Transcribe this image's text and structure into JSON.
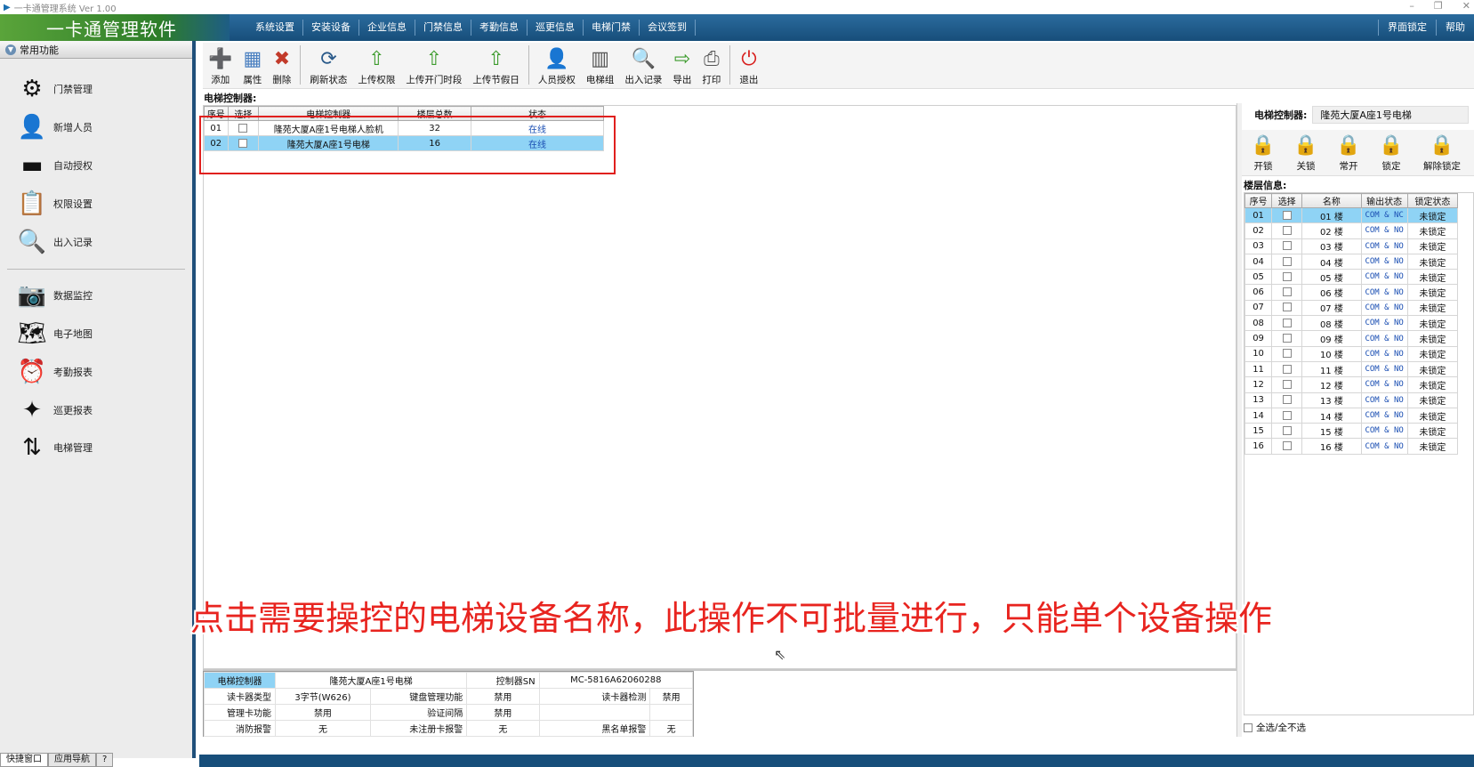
{
  "window": {
    "title": "一卡通管理系统  Ver 1.00",
    "controls": [
      "–",
      "❐",
      "✕"
    ]
  },
  "brand": "一卡通管理软件",
  "menu": [
    "系统设置",
    "安装设备",
    "企业信息",
    "门禁信息",
    "考勤信息",
    "巡更信息",
    "电梯门禁",
    "会议签到"
  ],
  "menu_right": [
    "界面锁定",
    "帮助"
  ],
  "sidebar": {
    "header": "常用功能",
    "group1": [
      {
        "label": "门禁管理",
        "icon": "access-control-icon"
      },
      {
        "label": "新增人员",
        "icon": "person-icon"
      },
      {
        "label": "自动授权",
        "icon": "card-icon"
      },
      {
        "label": "权限设置",
        "icon": "permission-icon"
      },
      {
        "label": "出入记录",
        "icon": "magnifier-icon"
      }
    ],
    "group2": [
      {
        "label": "数据监控",
        "icon": "camera-icon"
      },
      {
        "label": "电子地图",
        "icon": "map-icon"
      },
      {
        "label": "考勤报表",
        "icon": "clock-icon"
      },
      {
        "label": "巡更报表",
        "icon": "patrol-icon"
      },
      {
        "label": "电梯管理",
        "icon": "elevator-icon"
      }
    ],
    "tabs": [
      "快捷窗口",
      "应用导航",
      "?"
    ]
  },
  "toolbar": [
    {
      "label": "添加",
      "icon": "add-icon",
      "color": "#3a9a2a"
    },
    {
      "label": "属性",
      "icon": "properties-icon",
      "color": "#4a7fc0"
    },
    {
      "label": "删除",
      "icon": "delete-icon",
      "color": "#c23a2a"
    },
    {
      "label": "刷新状态",
      "icon": "refresh-icon",
      "color": "#2a5a8a"
    },
    {
      "label": "上传权限",
      "icon": "upload-icon",
      "color": "#3a9a2a"
    },
    {
      "label": "上传开门时段",
      "icon": "upload-time-icon",
      "color": "#3a9a2a"
    },
    {
      "label": "上传节假日",
      "icon": "upload-holiday-icon",
      "color": "#3a9a2a"
    },
    {
      "label": "人员授权",
      "icon": "user-auth-icon",
      "color": "#d07a2a"
    },
    {
      "label": "电梯组",
      "icon": "elevator-group-icon",
      "color": "#555555"
    },
    {
      "label": "出入记录",
      "icon": "record-search-icon",
      "color": "#3a7fc0"
    },
    {
      "label": "导出",
      "icon": "export-icon",
      "color": "#3a9a2a"
    },
    {
      "label": "打印",
      "icon": "print-icon",
      "color": "#555555"
    },
    {
      "label": "退出",
      "icon": "power-icon",
      "color": "#d8201e"
    }
  ],
  "controllers": {
    "label": "电梯控制器:",
    "columns": [
      "序号",
      "选择",
      "电梯控制器",
      "楼层总数",
      "状态"
    ],
    "rows": [
      {
        "no": "01",
        "name": "隆苑大厦A座1号电梯人脸机",
        "floors": "32",
        "status": "在线",
        "selected": false
      },
      {
        "no": "02",
        "name": "隆苑大厦A座1号电梯",
        "floors": "16",
        "status": "在线",
        "selected": true
      }
    ]
  },
  "info": {
    "controller_key": "电梯控制器",
    "controller_val": "隆苑大厦A座1号电梯",
    "sn_key": "控制器SN",
    "sn_val": "MC-5816A62060288",
    "reader_type_key": "读卡器类型",
    "reader_type_val": "3字节(W626)",
    "keypad_key": "键盘管理功能",
    "keypad_val": "禁用",
    "reader_detect_key": "读卡器检测",
    "reader_detect_val": "禁用",
    "admin_card_key": "管理卡功能",
    "admin_card_val": "禁用",
    "verify_key": "验证间隔",
    "verify_val": "禁用",
    "fire_key": "消防报警",
    "fire_val": "无",
    "unreg_key": "未注册卡报警",
    "unreg_val": "无",
    "blacklist_key": "黑名单报警",
    "blacklist_val": "无"
  },
  "right": {
    "controller_key": "电梯控制器:",
    "controller_val": "隆苑大厦A座1号电梯",
    "lock_buttons": [
      "开锁",
      "关锁",
      "常开",
      "锁定",
      "解除锁定"
    ],
    "floor_label": "楼层信息:",
    "floor_columns": [
      "序号",
      "选择",
      "名称",
      "输出状态",
      "锁定状态"
    ],
    "floors": [
      {
        "no": "01",
        "name": "01 楼",
        "out": "COM & NC",
        "lock": "未锁定"
      },
      {
        "no": "02",
        "name": "02 楼",
        "out": "COM & NO",
        "lock": "未锁定"
      },
      {
        "no": "03",
        "name": "03 楼",
        "out": "COM & NO",
        "lock": "未锁定"
      },
      {
        "no": "04",
        "name": "04 楼",
        "out": "COM & NO",
        "lock": "未锁定"
      },
      {
        "no": "05",
        "name": "05 楼",
        "out": "COM & NO",
        "lock": "未锁定"
      },
      {
        "no": "06",
        "name": "06 楼",
        "out": "COM & NO",
        "lock": "未锁定"
      },
      {
        "no": "07",
        "name": "07 楼",
        "out": "COM & NO",
        "lock": "未锁定"
      },
      {
        "no": "08",
        "name": "08 楼",
        "out": "COM & NO",
        "lock": "未锁定"
      },
      {
        "no": "09",
        "name": "09 楼",
        "out": "COM & NO",
        "lock": "未锁定"
      },
      {
        "no": "10",
        "name": "10 楼",
        "out": "COM & NO",
        "lock": "未锁定"
      },
      {
        "no": "11",
        "name": "11 楼",
        "out": "COM & NO",
        "lock": "未锁定"
      },
      {
        "no": "12",
        "name": "12 楼",
        "out": "COM & NO",
        "lock": "未锁定"
      },
      {
        "no": "13",
        "name": "13 楼",
        "out": "COM & NO",
        "lock": "未锁定"
      },
      {
        "no": "14",
        "name": "14 楼",
        "out": "COM & NO",
        "lock": "未锁定"
      },
      {
        "no": "15",
        "name": "15 楼",
        "out": "COM & NO",
        "lock": "未锁定"
      },
      {
        "no": "16",
        "name": "16 楼",
        "out": "COM & NO",
        "lock": "未锁定"
      }
    ],
    "select_all": "全选/全不选"
  },
  "caption": "点击需要操控的电梯设备名称，此操作不可批量进行，只能单个设备操作",
  "colors": {
    "menubar": "#174e7a",
    "selected_row": "#8fd3f5",
    "caption": "#e8241f",
    "highlight_box": "#e0201e"
  }
}
